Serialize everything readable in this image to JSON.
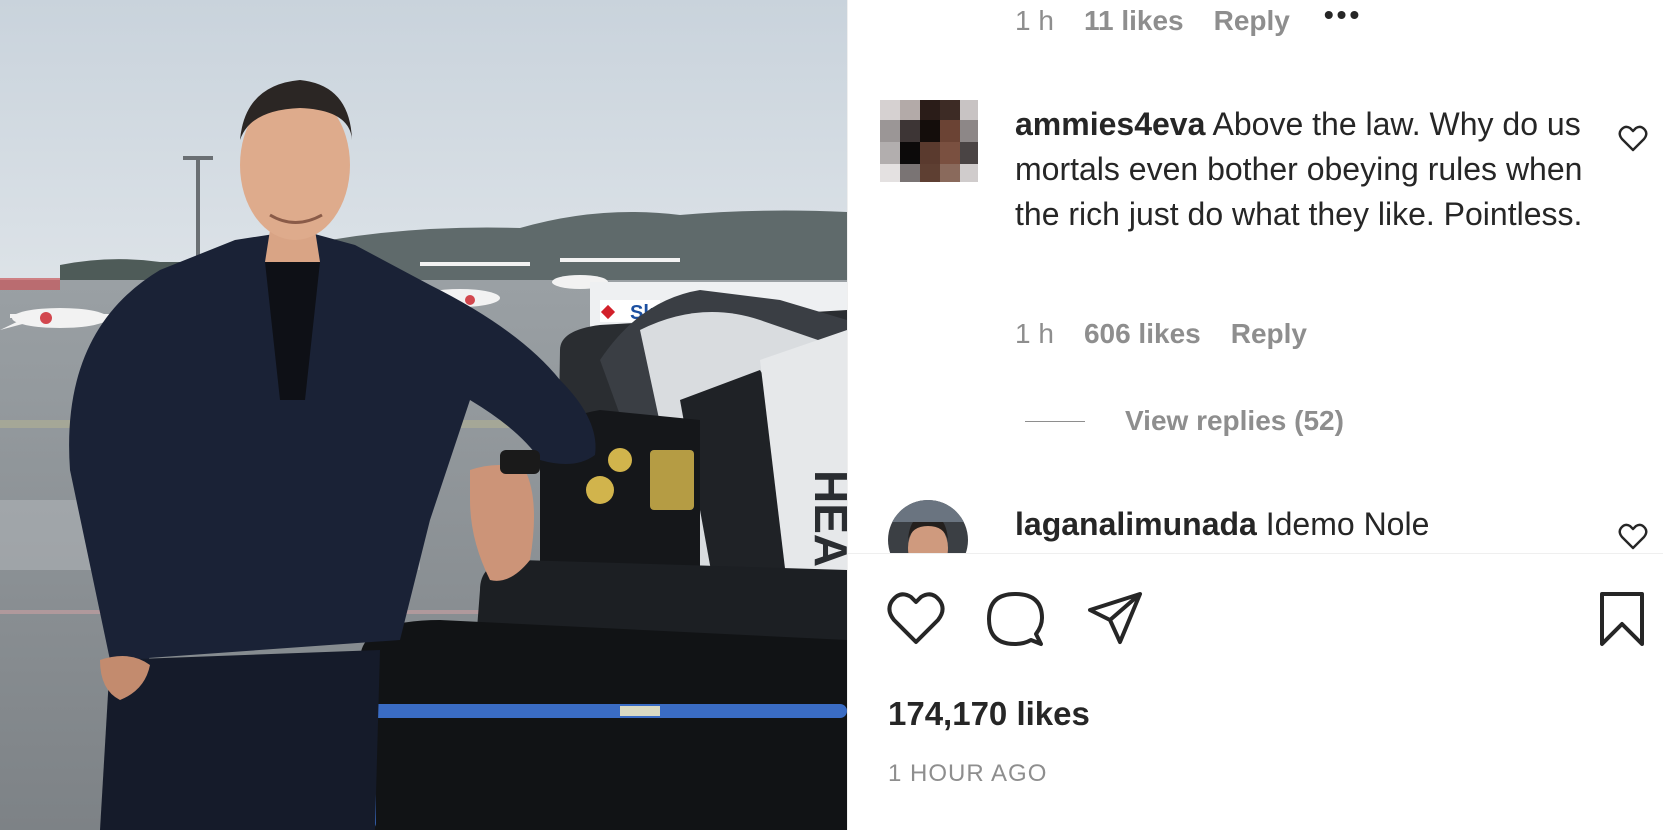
{
  "previous_comment_meta": {
    "time": "1 h",
    "likes": "11 likes",
    "reply": "Reply",
    "more": "•••"
  },
  "comments": [
    {
      "username": "ammies4eva",
      "text": "Above the law. Why do us mortals even bother obeying rules when the rich just do what they like. Pointless.",
      "time": "1 h",
      "likes": "606 likes",
      "reply": "Reply",
      "view_replies": "View replies (52)"
    },
    {
      "username": "laganalimunada",
      "text": "Idemo Nole"
    }
  ],
  "actions": {
    "like_icon": "heart-outline-icon",
    "comment_icon": "speech-bubble-icon",
    "share_icon": "paper-plane-icon",
    "save_icon": "bookmark-icon"
  },
  "post": {
    "likes": "174,170 likes",
    "timestamp": "1 HOUR AGO"
  },
  "photo": {
    "bag_brand": "HEAD",
    "truck_text": "Sk"
  },
  "colors": {
    "text_primary": "#262626",
    "text_secondary": "#8e8e8e",
    "divider": "#efefef"
  }
}
